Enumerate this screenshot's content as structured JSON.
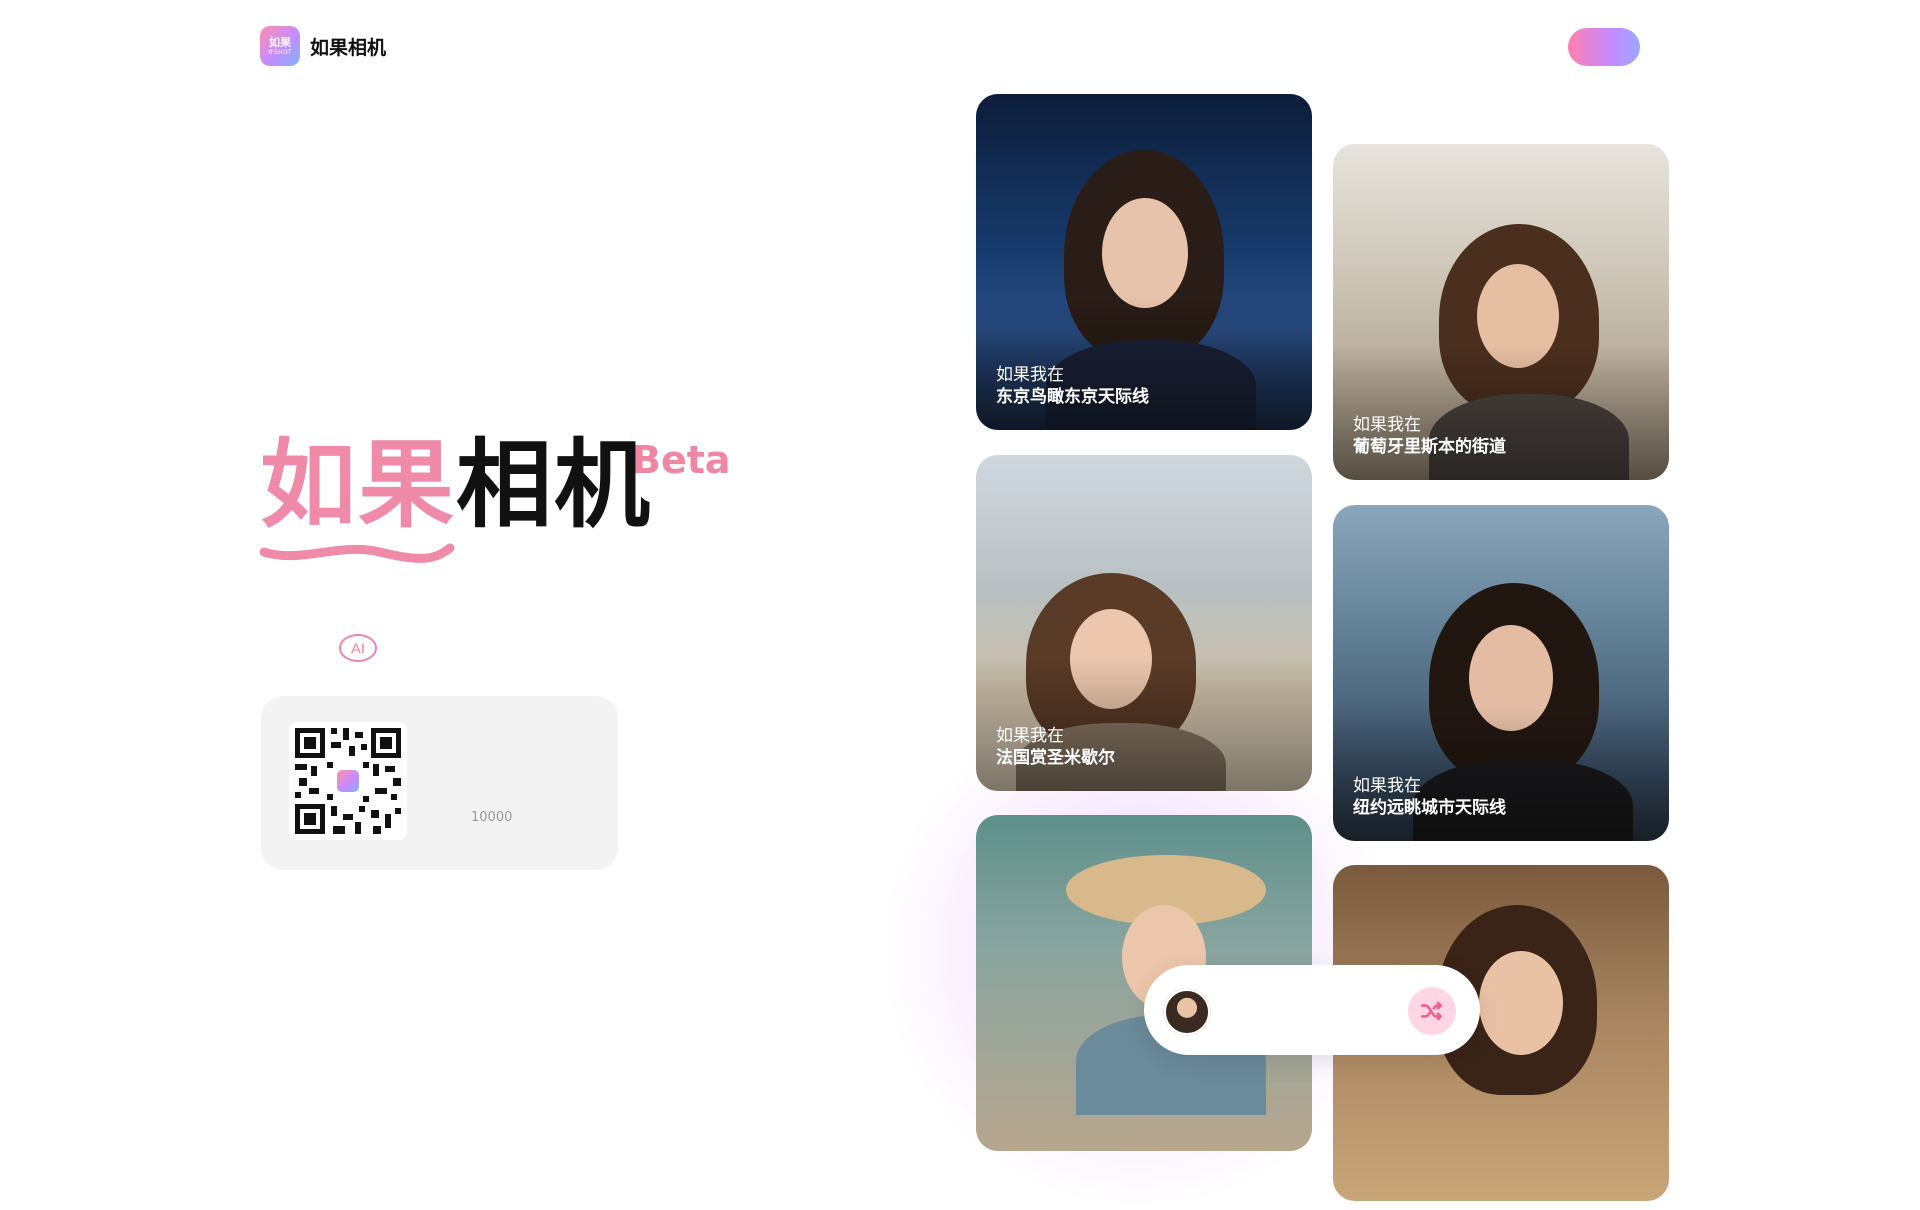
{
  "header": {
    "logo_icon_line1": "如果",
    "logo_icon_line2": "IFSHOT",
    "app_name": "如果相机"
  },
  "hero": {
    "title_part1": "如果",
    "title_part2": "相机",
    "badge": "Beta",
    "ai_icon_label": "AI"
  },
  "qr_card": {
    "count": "10000"
  },
  "gallery": [
    {
      "prefix": "如果我在",
      "place": "东京鸟瞰东京天际线"
    },
    {
      "prefix": "如果我在",
      "place": "葡萄牙里斯本的街道"
    },
    {
      "prefix": "如果我在",
      "place": "法国赏圣米歇尔"
    },
    {
      "prefix": "如果我在",
      "place": "纽约远眺城市天际线"
    }
  ],
  "colors": {
    "brand_pink": "#ef8aa8",
    "shuffle_bg": "#ffd6e3",
    "card_bg": "#f3f3f3"
  },
  "icons": {
    "shuffle": "shuffle-icon",
    "ai": "ai-icon",
    "qr": "qr-code-icon"
  }
}
